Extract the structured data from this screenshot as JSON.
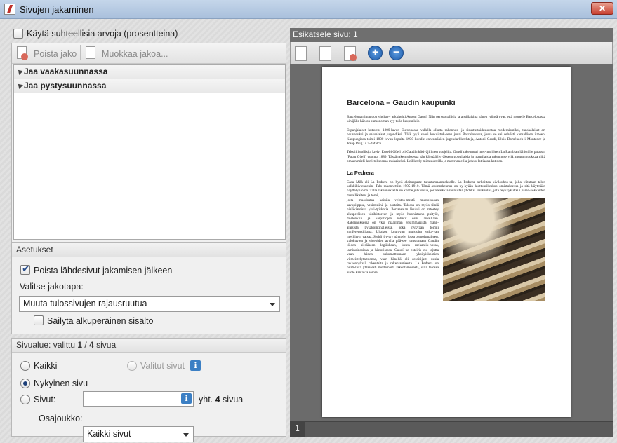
{
  "window": {
    "title": "Sivujen jakaminen",
    "close_symbol": "✕"
  },
  "left": {
    "relative_values_label": "Käytä suhteellisia arvoja (prosentteina)",
    "relative_values_checked": false,
    "toolbar": {
      "remove_split_label": "Poista jako",
      "edit_split_label": "Muokkaa jakoa..."
    },
    "tree": [
      {
        "label": "Jaa vaakasuunnassa"
      },
      {
        "label": "Jaa pystysuunnassa"
      }
    ],
    "settings": {
      "header": "Asetukset",
      "delete_source_label": "Poista lähdesivut jakamisen jälkeen",
      "delete_source_checked": true,
      "split_method_label": "Valitse jakotapa:",
      "split_method_value": "Muuta tulossivujen rajausruutua",
      "keep_content_label": "Säilytä alkuperäinen sisältö",
      "keep_content_checked": false
    },
    "range": {
      "header_prefix": "Sivualue: valittu ",
      "selected": "1",
      "header_mid": " / ",
      "total": "4",
      "header_suffix": " sivua",
      "all_label": "Kaikki",
      "selected_pages_label": "Valitut sivut",
      "current_label": "Nykyinen sivu",
      "pages_label": "Sivut:",
      "pages_input_value": "",
      "total_prefix": "yht. ",
      "total_count": "4",
      "total_suffix": " sivua",
      "subset_label": "Osajoukko:",
      "subset_value": "Kaikki sivut",
      "selected_option": "current"
    }
  },
  "preview": {
    "header": "Esikatsele sivu: 1",
    "page_number": "1",
    "zoom_in_symbol": "+",
    "zoom_out_symbol": "−",
    "document": {
      "title": "Barcelona – Gaudin kaupunki",
      "paragraphs": [
        "Barcelonan imagoon yhdistyy arkkitehti Antoni Gaudí. Niin persoonallisia ja aistillaisina hänen työnsä ovat, että monelle Barcelonassa kävijälle hän on sumonoman syy tulla kaupunkiin.",
        "Espanjalaiset kutsuvat 1800-luvun Euroopassa vallalla ollutta rakennus- ja sisustustaidesuuntaa modernismiksi, tanskalaiset art nouveauksi ja saksalaiset jugendiksi. Tätä tyyli suosi kukoistuk-seen juuri Barcelonassa, jossa se sai selvästi kansallisen ilmeen. Kaupungissa toimi 1800-luvun lopulta 1930-luvulle ennennäkien jugendarkkitehteja, Antoni Gaudí, Lluis Domènech i Montaner ja Josep Puig i Ca-dafalch.",
        "Tekstiiliteollisija kreivi Eusebi Güell oli Gaudín käsiväjillinen suojelija. Gaudí rakennutti mes-marilleen La Ramblan lähistölle palatsin (Palau Güell) vuonna 1889. Tässä rakennuksessa hän käyttää hyväkseen goottilaisia ja maurilaisia rakennustyyliä, mutta muokkaa niitä omaan mieli-kuvi-tukseensa mukaiseksi. Leikkitely mittasuhteilla ja materiaaleilla jatkuu lattiaana kattoon."
      ],
      "subtitle": "La Pedrera",
      "lead_paragraph": "Casa Milà eli La Pedrera on hyvä aloituspaste tutustumaanteokselle. La Pedrera tarkoittaa kivilouhos-ta, jolla viitataan talon kalkkikivieneenin. Talo rakennettiin 1905-1910. Tämä asuinrakennus on ny-kyään kulttuurikeskus omistuksessa ja sitä käytetään näyttelytiloina. Tällä rakennuksella on kolme julkisivua, joita kaikkia reunustaa yhdeksi kivikantoa, jota reykkykutteili paraa-vekkeiden metallikaiteet ja torni,",
      "body_paragraph": "joita muodostaa kaiuila veistos-mestä muotoisuoan savupiippua, vesistisiinä ja portaita. Talossa on myös tiiniä nieläkiatoissa yksi-tyiskotia. Portaasalan lisuksi on ratostey alkuperäisen värihistoreen ja myös huonistaino puityöt, mielenkiin ja keipattojen reliefit ovat ainaillaan. Rakennuksessa on yksi maailman ensimmäisistä maan-alaisista pysäköintihalleista, joka nykyään toimii konferenssitilana. Ullakon kuuluvan muistoita valta-van mechirvin vatsaa. Sieltä löy-tyy näyttely, jossa pienoismalleen, valokuvien ja videoiden avulla pää-see tutustumaan Gaudín töiden si-säiseen logiikkaan, kuten mekaniik-nossa, laminoinsoissa ja histori-assa. Gaudí ne esteiris cui tajutta vaan hänen sukumattomaan yksityiskohtien viimeistelytaitoonsa, vaan häneltä oli cessisijasti uusia rakkennyksiä rakentelta ja rakentamisesta. La Pedrera on ovati-lista yhteisesti moderneita rakentamosesta, sillä talossa ei ole kantavia seiniä."
    }
  },
  "colors": {
    "accent_blue": "#1e5ba8",
    "close_red": "#c84030"
  },
  "icons": [
    "app-icon",
    "close-icon",
    "remove-split-icon",
    "edit-split-icon",
    "info-icon",
    "zoom-in-icon",
    "zoom-out-icon",
    "page-icon"
  ]
}
